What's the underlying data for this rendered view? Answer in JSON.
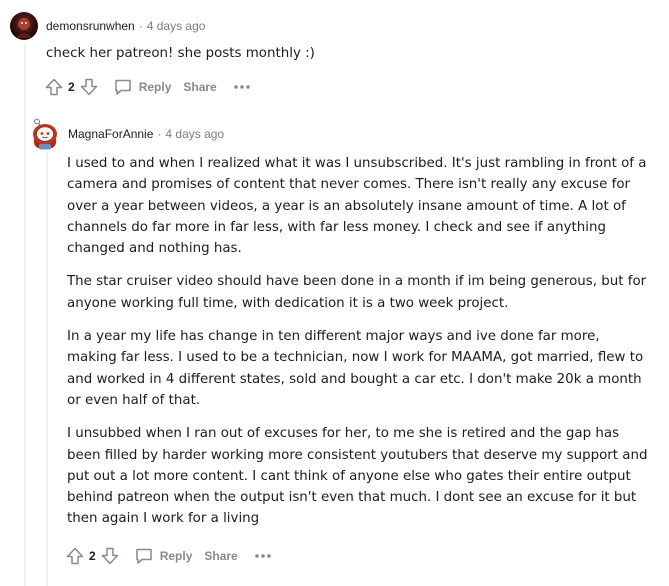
{
  "comments": [
    {
      "username": "demonsrunwhen",
      "separator": "·",
      "time": "4 days ago",
      "paragraphs": [
        "check her patreon! she posts monthly :)"
      ],
      "votes": "2",
      "reply_label": "Reply",
      "share_label": "Share",
      "more_label": "•••"
    },
    {
      "username": "MagnaForAnnie",
      "separator": "·",
      "time": "4 days ago",
      "paragraphs": [
        "I used to and when I realized what it was I unsubscribed. It's just rambling in front of a camera and promises of content that never comes. There isn't really any excuse for over a year between videos, a year is an absolutely insane amount of time. A lot of channels do far more in far less, with far less money. I check and see if anything changed and nothing has.",
        "The star cruiser video should have been done in a month if im being generous, but for anyone working full time, with dedication it is a two week project.",
        "In a year my life has change in ten different major ways and ive done far more, making far less. I used to be a technician, now I work for MAAMA, got married, flew to and worked in 4 different states, sold and bought a car etc. I don't make 20k a month or even half of that.",
        "I unsubbed when I ran out of excuses for her, to me she is retired and the gap has been filled by harder working more consistent youtubers that deserve my support and put out a lot more content. I cant think of anyone else who gates their entire output behind patreon when the output isn't even that much. I dont see an excuse for it but then again I work for a living"
      ],
      "votes": "2",
      "reply_label": "Reply",
      "share_label": "Share",
      "more_label": "•••"
    }
  ],
  "colors": {
    "text": "#1c1c1c",
    "meta": "#7c7c7c",
    "action": "#878a8c",
    "thread_line": "#edeff1"
  },
  "icons": {
    "upvote": "arrow-up-outline-icon",
    "downvote": "arrow-down-outline-icon",
    "reply": "speech-bubble-icon",
    "more": "more-horizontal-icon"
  }
}
